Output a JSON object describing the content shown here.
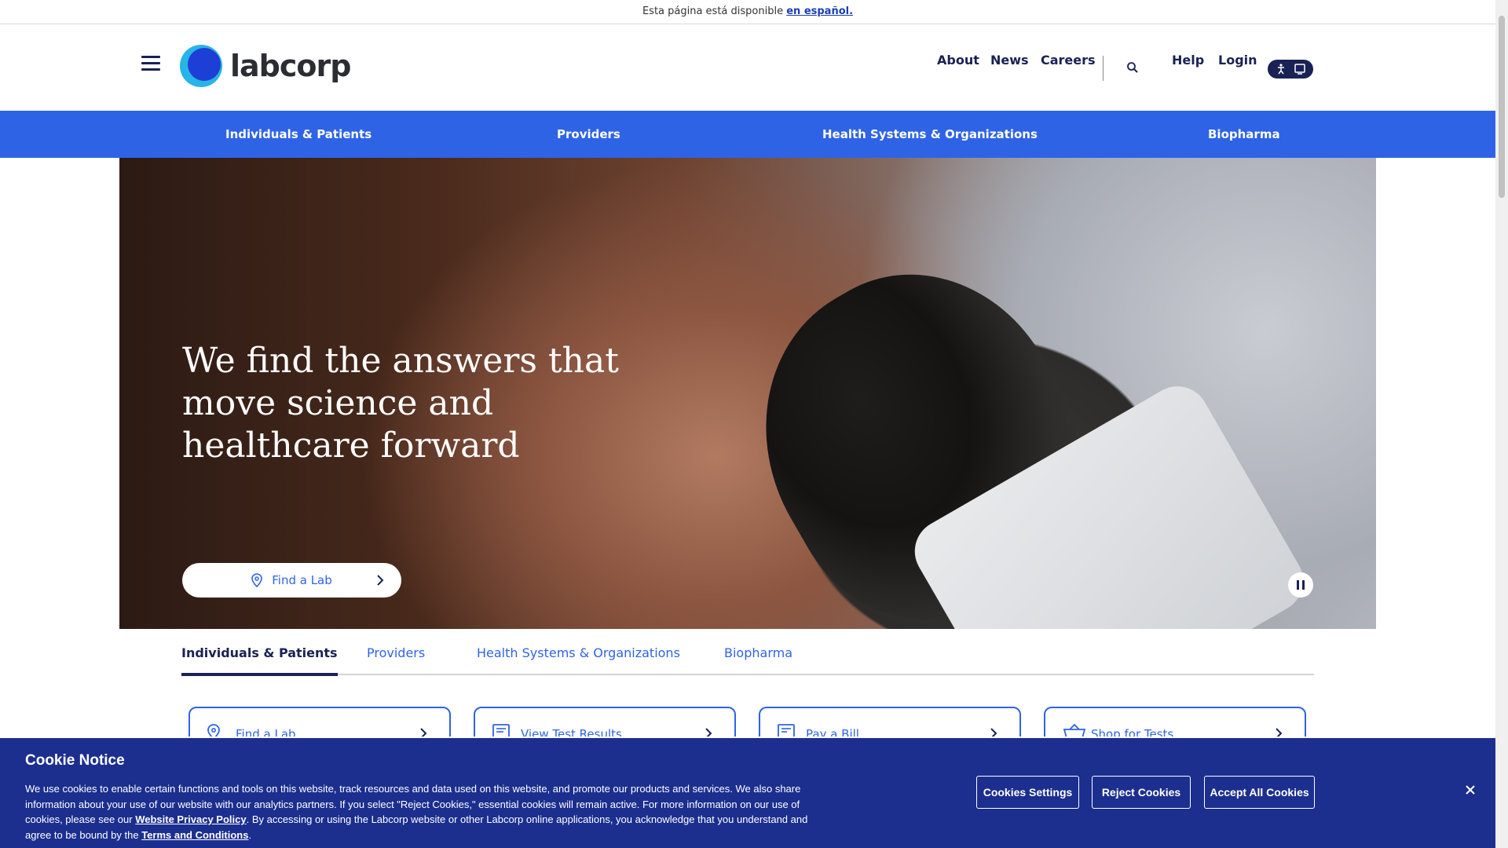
{
  "lang_banner": {
    "text": "Esta página está disponible ",
    "link": "en español."
  },
  "header": {
    "logo_text": "labcorp",
    "util_nav": [
      "About",
      "News",
      "Careers",
      "Help",
      "Login"
    ]
  },
  "main_nav": [
    "Individuals & Patients",
    "Providers",
    "Health Systems & Organizations",
    "Biopharma"
  ],
  "hero": {
    "title": "We find the answers that move science and healthcare forward",
    "button": "Find a Lab"
  },
  "tabs": [
    "Individuals & Patients",
    "Providers",
    "Health Systems & Organizations",
    "Biopharma"
  ],
  "cards": [
    "Find a Lab",
    "View Test Results",
    "Pay a Bill",
    "Shop for Tests"
  ],
  "cookie": {
    "title": "Cookie Notice",
    "text1": "We use cookies to enable certain functions and tools on this website, track resources and data used on this website, and promote our products and services. We also share information about your use of our website with our analytics partners. If you select \"Reject Cookies,\" essential cookies will remain active. For more information on our use of cookies, please see our ",
    "link1": "Website Privacy Policy",
    "text2": ". By accessing or using the Labcorp website or other Labcorp online applications, you acknowledge that you understand and agree to be bound by the ",
    "link2": "Terms and Conditions",
    "text3": ".",
    "settings_button": "Cookies Settings",
    "reject_button": "Reject Cookies",
    "accept_button": "Accept All Cookies"
  },
  "colors": {
    "brand_blue": "#2f63e6",
    "navy": "#1a2155",
    "cookie_bg": "#1c2f8f"
  }
}
